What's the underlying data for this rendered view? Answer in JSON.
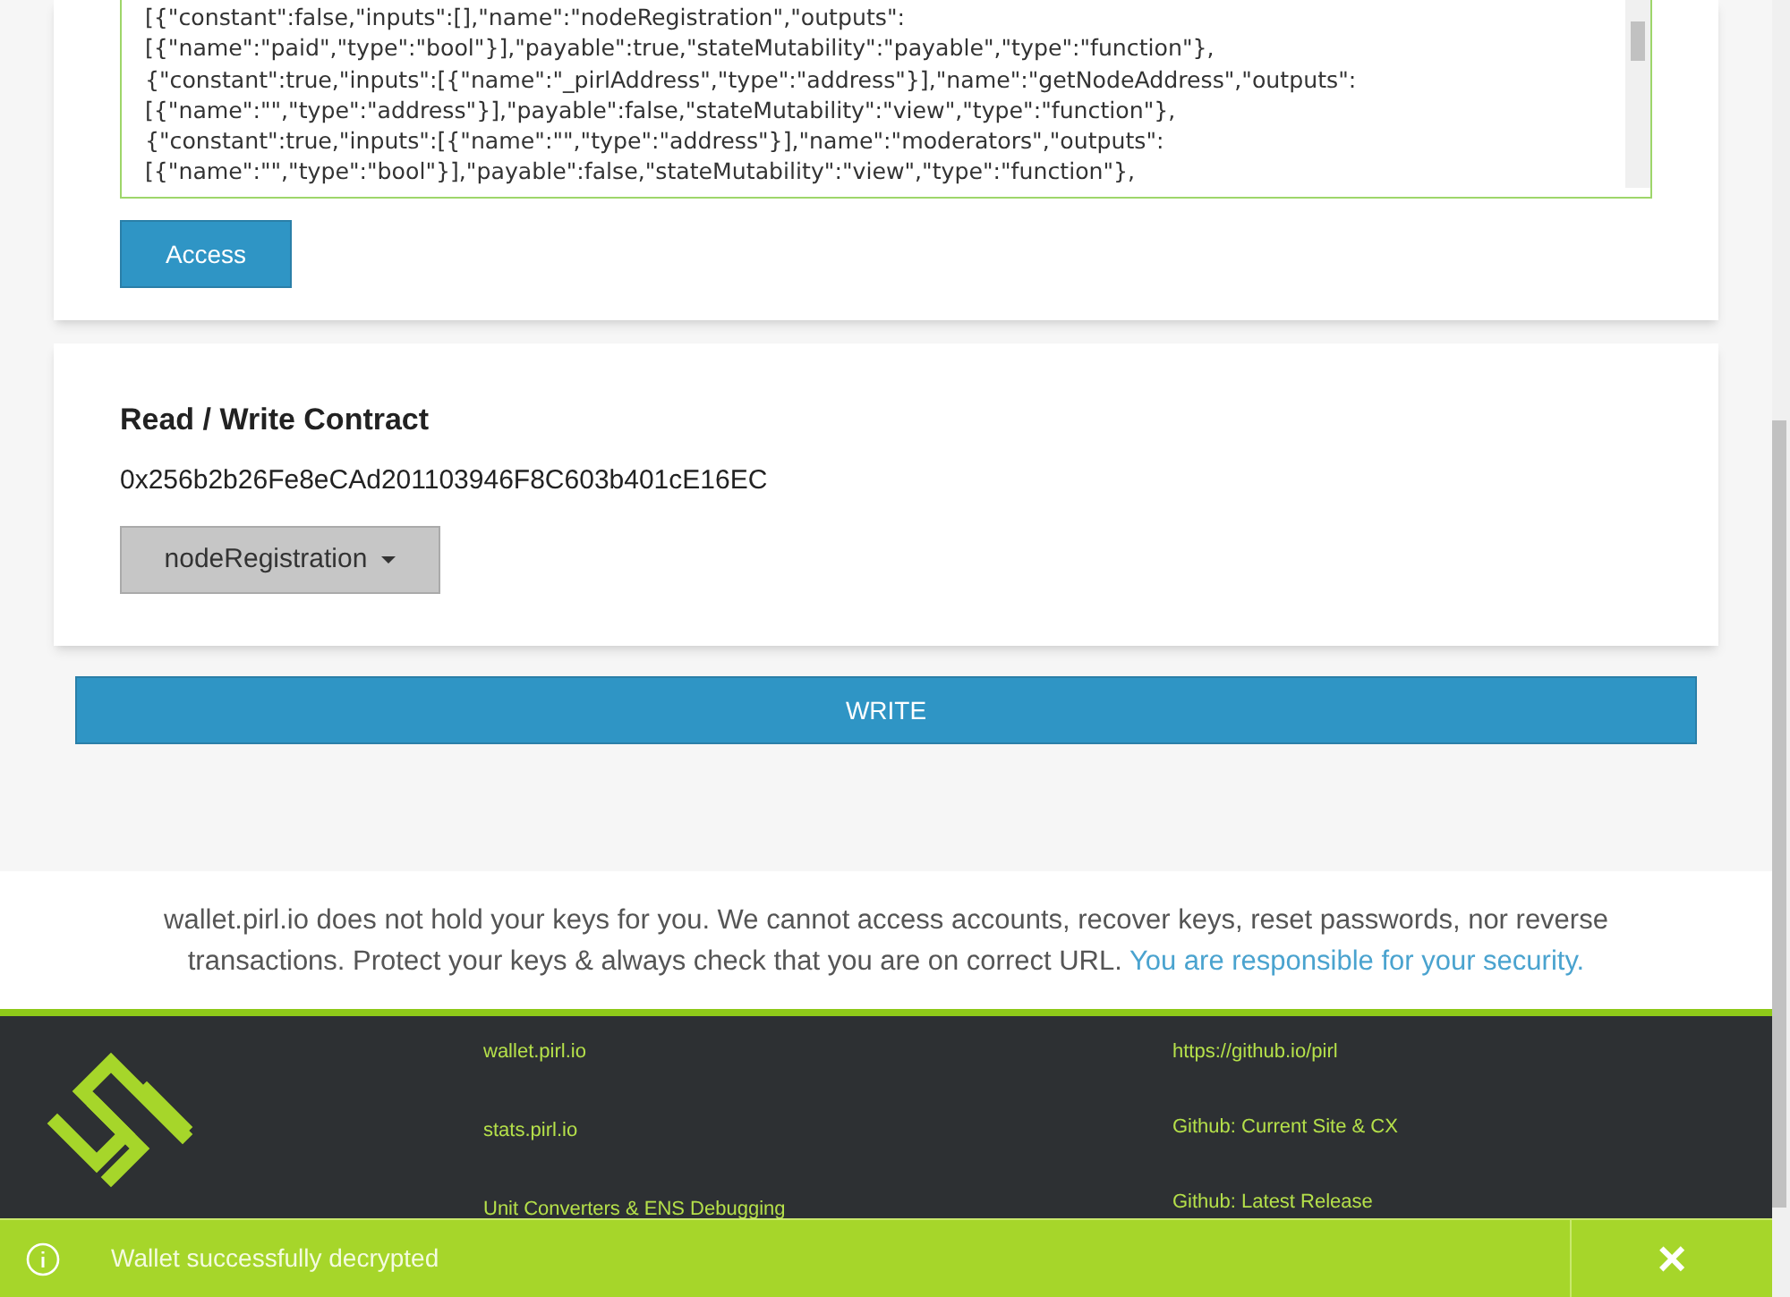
{
  "abi_field": {
    "lines": [
      "[{\"constant\":false,\"inputs\":[],\"name\":\"nodeRegistration\",\"outputs\":",
      "[{\"name\":\"paid\",\"type\":\"bool\"}],\"payable\":true,\"stateMutability\":\"payable\",\"type\":\"function\"},",
      "{\"constant\":true,\"inputs\":[{\"name\":\"_pirlAddress\",\"type\":\"address\"}],\"name\":\"getNodeAddress\",\"outputs\":",
      "[{\"name\":\"\",\"type\":\"address\"}],\"payable\":false,\"stateMutability\":\"view\",\"type\":\"function\"},",
      "{\"constant\":true,\"inputs\":[{\"name\":\"\",\"type\":\"address\"}],\"name\":\"moderators\",\"outputs\":",
      "[{\"name\":\"\",\"type\":\"bool\"}],\"payable\":false,\"stateMutability\":\"view\",\"type\":\"function\"},"
    ]
  },
  "access_button": "Access",
  "contract": {
    "title": "Read / Write Contract",
    "address": "0x256b2b26Fe8eCAd201103946F8C603b401cE16EC",
    "function_dropdown": "nodeRegistration"
  },
  "write_button": "WRITE",
  "disclaimer": {
    "text": "wallet.pirl.io does not hold your keys for you. We cannot access accounts, recover keys, reset passwords, nor reverse transactions. Protect your keys & always check that you are on correct URL.",
    "link": "You are responsible for your security."
  },
  "footer": {
    "column_1": [
      "wallet.pirl.io",
      "stats.pirl.io",
      "Unit Converters & ENS Debugging"
    ],
    "column_2": [
      "https://github.io/pirl",
      "Github: Current Site & CX",
      "Github: Latest Release"
    ]
  },
  "toast": {
    "message": "Wallet successfully decrypted",
    "close": "×"
  }
}
